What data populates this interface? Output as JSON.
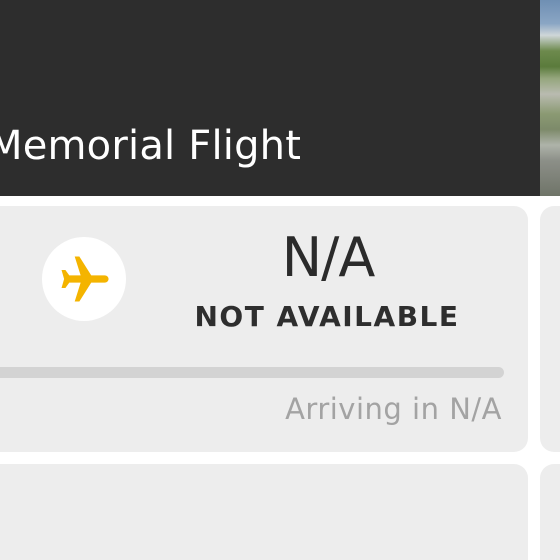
{
  "header": {
    "title": "Memorial Flight"
  },
  "flight_card": {
    "icon": "airplane-icon",
    "status_value": "N/A",
    "status_label": "NOT AVAILABLE",
    "progress_fraction": 0,
    "arrival_text": "Arriving in N/A"
  },
  "colors": {
    "header_bg": "#2d2d2d",
    "card_bg": "#ededed",
    "accent": "#f4b400",
    "progress_track": "#d3d3d3",
    "muted_text": "#a3a3a3"
  }
}
